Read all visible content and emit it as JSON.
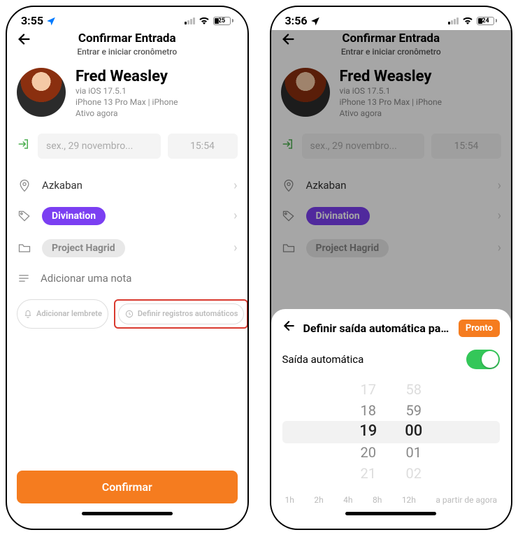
{
  "left": {
    "status": {
      "time": "3:55",
      "battery": "25"
    },
    "header": {
      "title": "Confirmar Entrada",
      "subtitle": "Entrar e iniciar cronômetro"
    },
    "profile": {
      "name": "Fred Weasley",
      "line1": "via iOS 17.5.1",
      "line2": "iPhone 13 Pro Max | iPhone",
      "line3": "Ativo agora"
    },
    "datetime": {
      "date": "sex., 29 novembro...",
      "time": "15:54"
    },
    "location": "Azkaban",
    "tag": "Divination",
    "project": "Project Hagrid",
    "note_placeholder": "Adicionar uma nota",
    "chip_reminder": "Adicionar lembrete",
    "chip_auto": "Definir registros automáticos",
    "confirm": "Confirmar"
  },
  "right": {
    "status": {
      "time": "3:56",
      "battery": "24"
    },
    "header": {
      "title": "Confirmar Entrada",
      "subtitle": "Entrar e iniciar cronômetro"
    },
    "profile": {
      "name": "Fred Weasley",
      "line1": "via iOS 17.5.1",
      "line2": "iPhone 13 Pro Max | iPhone",
      "line3": "Ativo agora"
    },
    "datetime": {
      "date": "sex., 29 novembro...",
      "time": "15:54"
    },
    "location": "Azkaban",
    "tag": "Divination",
    "project": "Project Hagrid",
    "sheet": {
      "title": "Definir saída automática para...",
      "done": "Pronto",
      "toggle_label": "Saída automática",
      "hours": [
        "17",
        "18",
        "19",
        "20",
        "21"
      ],
      "minutes": [
        "58",
        "59",
        "00",
        "01",
        "02"
      ],
      "selected_hour_index": 2,
      "selected_min_index": 2,
      "quick": [
        "1h",
        "2h",
        "4h",
        "8h",
        "12h",
        "a partir de agora"
      ]
    }
  }
}
